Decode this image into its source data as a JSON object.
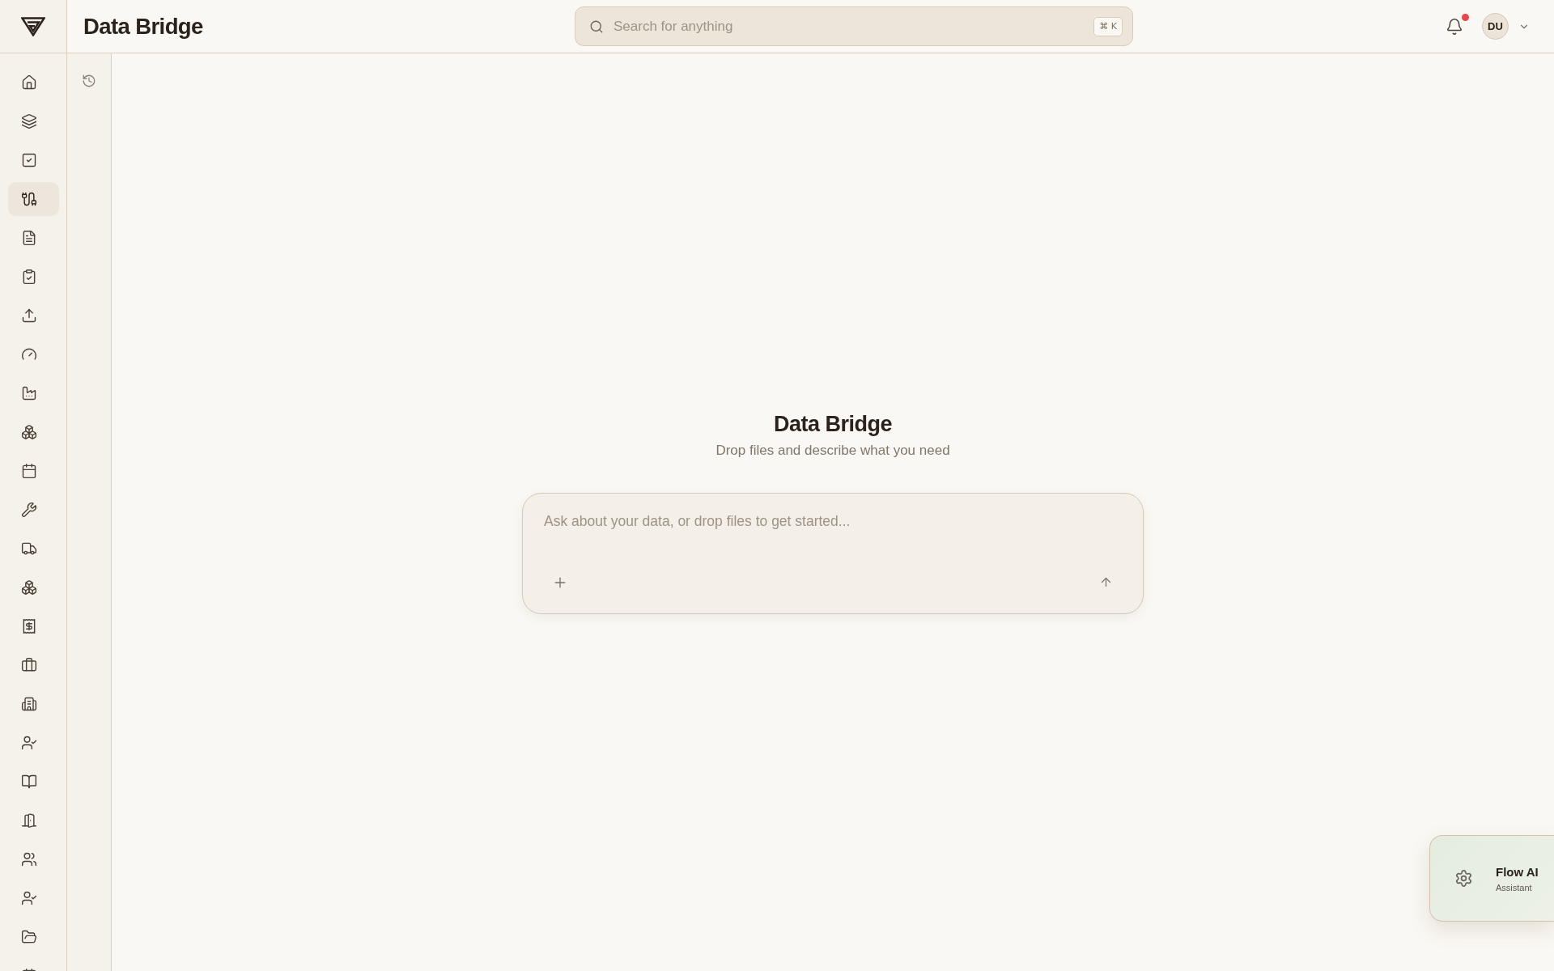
{
  "header": {
    "title": "Data Bridge",
    "search": {
      "placeholder": "Search for anything",
      "shortcut": "⌘ K"
    },
    "notifications": {
      "unread": true
    },
    "user": {
      "initials": "DU"
    }
  },
  "sidebar": {
    "items": [
      {
        "selected": false
      },
      {
        "selected": false
      },
      {
        "selected": false
      },
      {
        "selected": true
      },
      {
        "selected": false
      },
      {
        "selected": false
      },
      {
        "selected": false
      },
      {
        "selected": false
      },
      {
        "selected": false
      },
      {
        "selected": false
      },
      {
        "selected": false
      },
      {
        "selected": false
      },
      {
        "selected": false
      },
      {
        "selected": false
      },
      {
        "selected": false
      },
      {
        "selected": false
      },
      {
        "selected": false
      },
      {
        "selected": false
      },
      {
        "selected": false
      },
      {
        "selected": false
      },
      {
        "selected": false
      },
      {
        "selected": false
      },
      {
        "selected": false
      },
      {
        "selected": false
      }
    ]
  },
  "main": {
    "title": "Data Bridge",
    "subtitle": "Drop files and describe what you need",
    "composer": {
      "placeholder": "Ask about your data, or drop files to get started..."
    }
  },
  "assistant": {
    "title": "Flow AI",
    "subtitle": "Assistant"
  }
}
